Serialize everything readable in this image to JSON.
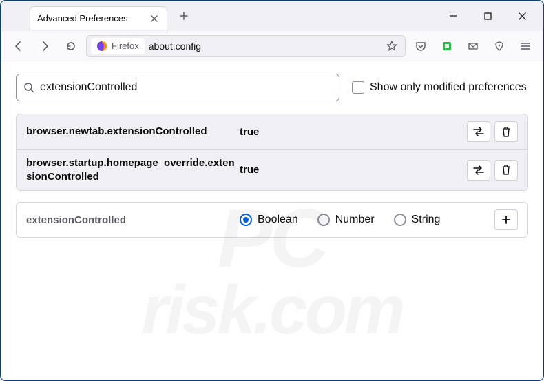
{
  "tab": {
    "title": "Advanced Preferences"
  },
  "urlbar": {
    "identity": "Firefox",
    "url": "about:config"
  },
  "search": {
    "value": "extensionControlled"
  },
  "checkbox": {
    "label": "Show only modified preferences",
    "checked": false
  },
  "results": [
    {
      "name": "browser.newtab.extensionControlled",
      "value": "true"
    },
    {
      "name": "browser.startup.homepage_override.extensionControlled",
      "value": "true"
    }
  ],
  "add": {
    "name": "extensionControlled",
    "types": [
      "Boolean",
      "Number",
      "String"
    ],
    "selected": "Boolean"
  },
  "watermark": {
    "line1": "PC",
    "line2": "risk.com"
  }
}
